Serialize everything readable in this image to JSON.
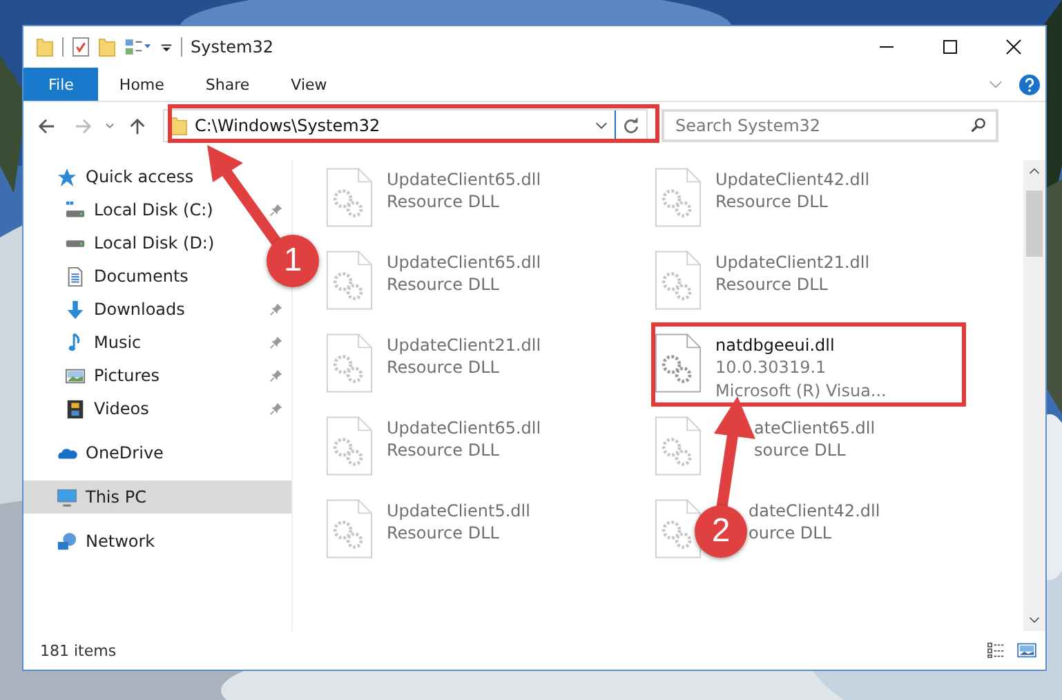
{
  "window": {
    "title": "System32"
  },
  "ribbon_tabs": [
    {
      "label": "File",
      "selected": true
    },
    {
      "label": "Home",
      "selected": false
    },
    {
      "label": "Share",
      "selected": false
    },
    {
      "label": "View",
      "selected": false
    }
  ],
  "address": {
    "path": "C:\\Windows\\System32"
  },
  "search": {
    "placeholder": "Search System32"
  },
  "sidebar": {
    "items": [
      {
        "label": "Quick access",
        "kind": "star",
        "selected": false,
        "pinned": false,
        "children": [
          {
            "label": "Local Disk (C:)",
            "kind": "system-drive",
            "selected": false,
            "pinned": true
          },
          {
            "label": "Local Disk (D:)",
            "kind": "drive",
            "selected": false
          },
          {
            "label": "Documents",
            "kind": "documents",
            "selected": false
          },
          {
            "label": "Downloads",
            "kind": "downloads",
            "selected": false,
            "pinned": true
          },
          {
            "label": "Music",
            "kind": "music",
            "selected": false,
            "pinned": true
          },
          {
            "label": "Pictures",
            "kind": "pictures",
            "selected": false,
            "pinned": true
          },
          {
            "label": "Videos",
            "kind": "videos",
            "selected": false,
            "pinned": true
          }
        ]
      },
      {
        "label": "OneDrive",
        "kind": "cloud",
        "selected": false,
        "pinned": false
      },
      {
        "label": "This PC",
        "kind": "pc",
        "selected": true,
        "pinned": false
      },
      {
        "label": "Network",
        "kind": "network",
        "selected": false,
        "pinned": false
      }
    ]
  },
  "files": [
    {
      "name": "UpdateClient65.dll",
      "lines": [
        "Resource DLL"
      ],
      "blurred": true
    },
    {
      "name": "UpdateClient42.dll",
      "lines": [
        "Resource DLL"
      ],
      "blurred": true
    },
    {
      "name": "UpdateClient65.dll",
      "lines": [
        "Resource DLL"
      ],
      "blurred": true
    },
    {
      "name": "UpdateClient21.dll",
      "lines": [
        "Resource DLL"
      ],
      "blurred": true
    },
    {
      "name": "UpdateClient21.dll",
      "lines": [
        "Resource DLL"
      ],
      "blurred": true
    },
    {
      "name": "natdbgeeui.dll",
      "lines": [
        "10.0.30319.1",
        "Microsoft (R) Visua..."
      ],
      "blurred": false
    },
    {
      "name": "UpdateClient65.dll",
      "lines": [
        "Resource DLL"
      ],
      "blurred": true
    },
    {
      "name": "ateClient65.dll",
      "lines": [
        "source DLL"
      ],
      "blurred": true
    },
    {
      "name": "UpdateClient5.dll",
      "lines": [
        "Resource DLL"
      ],
      "blurred": true
    },
    {
      "name": "dateClient42.dll",
      "lines": [
        "ource DLL"
      ],
      "blurred": true
    }
  ],
  "status_bar": {
    "count": "181 items"
  },
  "annotations": [
    {
      "label": "1"
    },
    {
      "label": "2"
    }
  ]
}
